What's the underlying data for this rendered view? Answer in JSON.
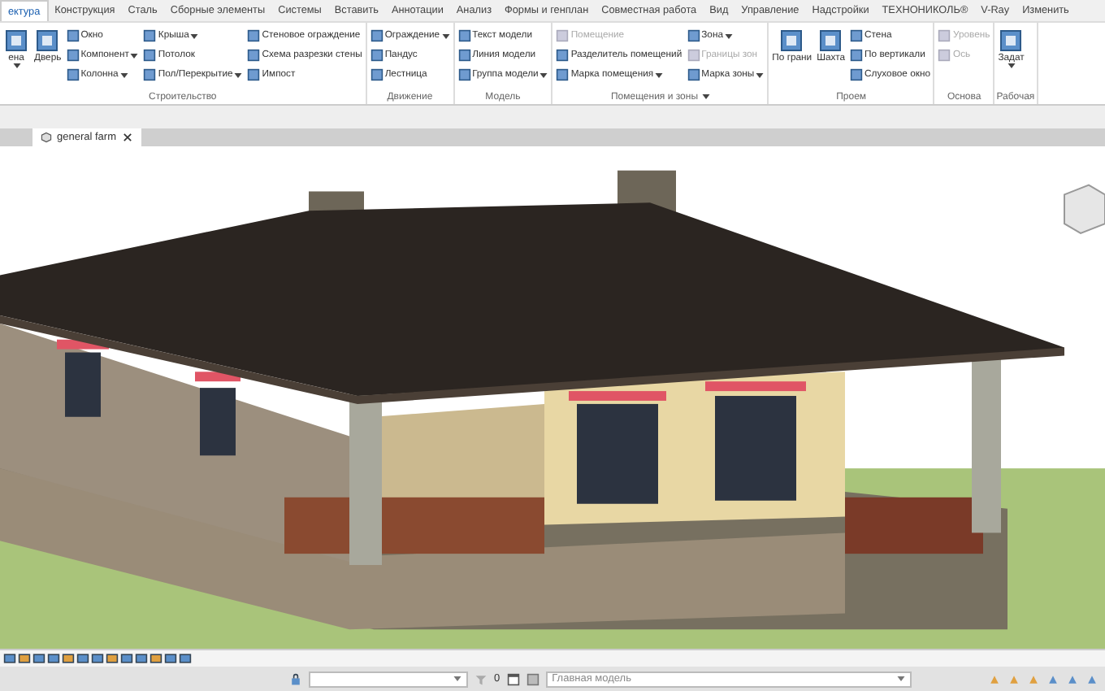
{
  "tabs": [
    {
      "label": "ектура",
      "selected": true
    },
    {
      "label": "Конструкция",
      "selected": false
    },
    {
      "label": "Сталь",
      "selected": false
    },
    {
      "label": "Сборные элементы",
      "selected": false
    },
    {
      "label": "Системы",
      "selected": false
    },
    {
      "label": "Вставить",
      "selected": false
    },
    {
      "label": "Аннотации",
      "selected": false
    },
    {
      "label": "Анализ",
      "selected": false
    },
    {
      "label": "Формы и генплан",
      "selected": false
    },
    {
      "label": "Совместная работа",
      "selected": false
    },
    {
      "label": "Вид",
      "selected": false
    },
    {
      "label": "Управление",
      "selected": false
    },
    {
      "label": "Надстройки",
      "selected": false
    },
    {
      "label": "ТЕХНОНИКОЛЬ®",
      "selected": false
    },
    {
      "label": "V-Ray",
      "selected": false
    },
    {
      "label": "Изменить",
      "selected": false
    }
  ],
  "ribbon": {
    "panels": [
      {
        "label": "Строительство",
        "has_menu": false,
        "columns": [
          [
            {
              "label": "ена",
              "kind": "large",
              "has_menu": true,
              "disabled": false
            },
            {
              "label": "Дверь",
              "kind": "large",
              "has_menu": false,
              "disabled": false
            }
          ],
          [
            {
              "label": "Окно",
              "kind": "small",
              "has_menu": false,
              "disabled": false
            },
            {
              "label": "Компонент",
              "kind": "small",
              "has_menu": true,
              "disabled": false
            },
            {
              "label": "Колонна",
              "kind": "small",
              "has_menu": true,
              "disabled": false
            }
          ],
          [
            {
              "label": "Крыша",
              "kind": "small",
              "has_menu": true,
              "disabled": false
            },
            {
              "label": "Потолок",
              "kind": "small",
              "has_menu": false,
              "disabled": false
            },
            {
              "label": "Пол/Перекрытие",
              "kind": "small",
              "has_menu": true,
              "disabled": false
            }
          ],
          [
            {
              "label": "Стеновое ограждение",
              "kind": "small",
              "has_menu": false,
              "disabled": false
            },
            {
              "label": "Схема разрезки стены",
              "kind": "small",
              "has_menu": false,
              "disabled": false
            },
            {
              "label": "Импост",
              "kind": "small",
              "has_menu": false,
              "disabled": false
            }
          ]
        ]
      },
      {
        "label": "Движение",
        "has_menu": false,
        "columns": [
          [
            {
              "label": "Ограждение",
              "kind": "small",
              "has_menu": true,
              "disabled": false
            },
            {
              "label": "Пандус",
              "kind": "small",
              "has_menu": false,
              "disabled": false
            },
            {
              "label": "Лестница",
              "kind": "small",
              "has_menu": false,
              "disabled": false
            }
          ]
        ]
      },
      {
        "label": "Модель",
        "has_menu": false,
        "columns": [
          [
            {
              "label": "Текст модели",
              "kind": "small",
              "has_menu": false,
              "disabled": false
            },
            {
              "label": "Линия модели",
              "kind": "small",
              "has_menu": false,
              "disabled": false
            },
            {
              "label": "Группа модели",
              "kind": "small",
              "has_menu": true,
              "disabled": false
            }
          ]
        ]
      },
      {
        "label": "Помещения и зоны",
        "has_menu": true,
        "columns": [
          [
            {
              "label": "Помещение",
              "kind": "small",
              "has_menu": false,
              "disabled": true
            },
            {
              "label": "Разделитель помещений",
              "kind": "small",
              "has_menu": false,
              "disabled": false
            },
            {
              "label": "Марка помещения",
              "kind": "small",
              "has_menu": true,
              "disabled": false
            }
          ],
          [
            {
              "label": "Зона",
              "kind": "small",
              "has_menu": true,
              "disabled": false
            },
            {
              "label": "Границы зон",
              "kind": "small",
              "has_menu": false,
              "disabled": true
            },
            {
              "label": "Марка зоны",
              "kind": "small",
              "has_menu": true,
              "disabled": false
            }
          ]
        ]
      },
      {
        "label": "Проем",
        "has_menu": false,
        "columns": [
          [
            {
              "label": "По грани",
              "kind": "large",
              "has_menu": false,
              "disabled": false
            }
          ],
          [
            {
              "label": "Шахта",
              "kind": "large",
              "has_menu": false,
              "disabled": false
            }
          ],
          [
            {
              "label": "Стена",
              "kind": "small",
              "has_menu": false,
              "disabled": false
            },
            {
              "label": "По вертикали",
              "kind": "small",
              "has_menu": false,
              "disabled": false
            },
            {
              "label": "Слуховое окно",
              "kind": "small",
              "has_menu": false,
              "disabled": false
            }
          ]
        ]
      },
      {
        "label": "Основа",
        "has_menu": false,
        "columns": [
          [
            {
              "label": "Уровень",
              "kind": "small",
              "has_menu": false,
              "disabled": true
            },
            {
              "label": "Ось",
              "kind": "small",
              "has_menu": false,
              "disabled": true
            }
          ]
        ]
      },
      {
        "label": "Рабочая",
        "has_menu": false,
        "columns": [
          [
            {
              "label": "Задат",
              "kind": "large",
              "has_menu": true,
              "disabled": false
            }
          ]
        ]
      }
    ]
  },
  "document_tab": {
    "title": "general farm"
  },
  "status_bar": {
    "editing_value": "0",
    "model_combo": {
      "value": "Главная модель"
    }
  }
}
